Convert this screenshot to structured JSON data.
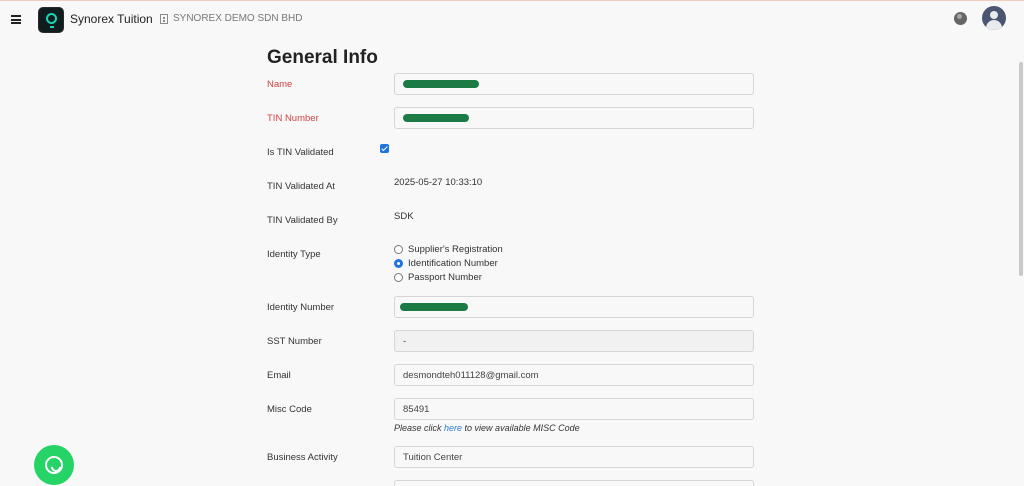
{
  "header": {
    "app_title": "Synorex Tuition",
    "company_name": "SYNOREX DEMO SDN BHD"
  },
  "icons": {
    "menu": "hamburger-icon",
    "logo": "synorex-logo",
    "company": "building-icon",
    "language": "globe-icon",
    "user": "avatar-icon",
    "chat": "whatsapp-icon"
  },
  "page": {
    "title": "General Info"
  },
  "form": {
    "name_label": "Name",
    "tin_label": "TIN Number",
    "tin_validated_label": "Is TIN Validated",
    "tin_validated_checked": true,
    "tin_validated_at_label": "TIN Validated At",
    "tin_validated_at_value": "2025-05-27 10:33:10",
    "tin_validated_by_label": "TIN Validated By",
    "tin_validated_by_value": "SDK",
    "identity_type_label": "Identity Type",
    "identity_type_options": [
      "Supplier's Registration",
      "Identification Number",
      "Passport Number"
    ],
    "identity_type_selected": "Identification Number",
    "identity_number_label": "Identity Number",
    "sst_label": "SST Number",
    "sst_value": "-",
    "email_label": "Email",
    "email_value": "desmondteh011128@gmail.com",
    "misc_label": "Misc Code",
    "misc_value": "85491",
    "misc_hint_before": "Please click ",
    "misc_hint_link": "here",
    "misc_hint_after": " to view available MISC Code",
    "business_activity_label": "Business Activity",
    "business_activity_value": "Tuition Center"
  },
  "colors": {
    "required_label": "#d04444",
    "accent": "#1e74e0",
    "whatsapp": "#25d366",
    "redaction": "#1c7a45"
  }
}
